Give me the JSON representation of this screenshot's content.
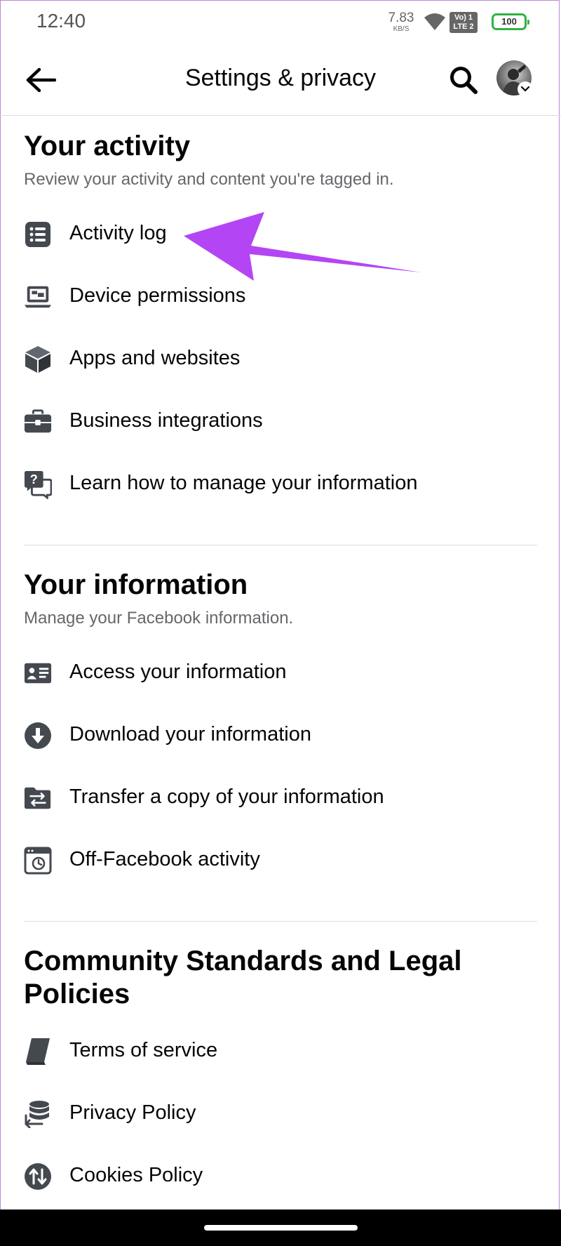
{
  "status_bar": {
    "time": "12:40",
    "net_speed": "7.83",
    "net_unit": "KB/S",
    "volte_line1": "Vo) 1",
    "volte_line2": "LTE 2",
    "battery": "100"
  },
  "header": {
    "title": "Settings & privacy",
    "back_icon": "arrow-left-icon",
    "search_icon": "search-icon"
  },
  "sections": {
    "activity": {
      "title": "Your activity",
      "subtitle": "Review your activity and content you're tagged in.",
      "items": [
        {
          "label": "Activity log",
          "icon": "list-icon"
        },
        {
          "label": "Device permissions",
          "icon": "laptop-icon"
        },
        {
          "label": "Apps and websites",
          "icon": "cube-icon"
        },
        {
          "label": "Business integrations",
          "icon": "briefcase-icon"
        },
        {
          "label": "Learn how to manage your information",
          "icon": "question-chat-icon"
        }
      ]
    },
    "information": {
      "title": "Your information",
      "subtitle": "Manage your Facebook information.",
      "items": [
        {
          "label": "Access your information",
          "icon": "id-card-icon"
        },
        {
          "label": "Download your information",
          "icon": "download-icon"
        },
        {
          "label": "Transfer a copy of your information",
          "icon": "folder-transfer-icon"
        },
        {
          "label": "Off-Facebook activity",
          "icon": "history-window-icon"
        }
      ]
    },
    "legal": {
      "title": "Community Standards and Legal Policies",
      "items": [
        {
          "label": "Terms of service",
          "icon": "book-icon"
        },
        {
          "label": "Privacy Policy",
          "icon": "database-icon"
        },
        {
          "label": "Cookies Policy",
          "icon": "cookie-arrows-icon"
        }
      ]
    }
  },
  "colors": {
    "annotation_arrow": "#b445f5",
    "icon": "#444950",
    "text": "#050505",
    "subtext": "#65676b"
  }
}
